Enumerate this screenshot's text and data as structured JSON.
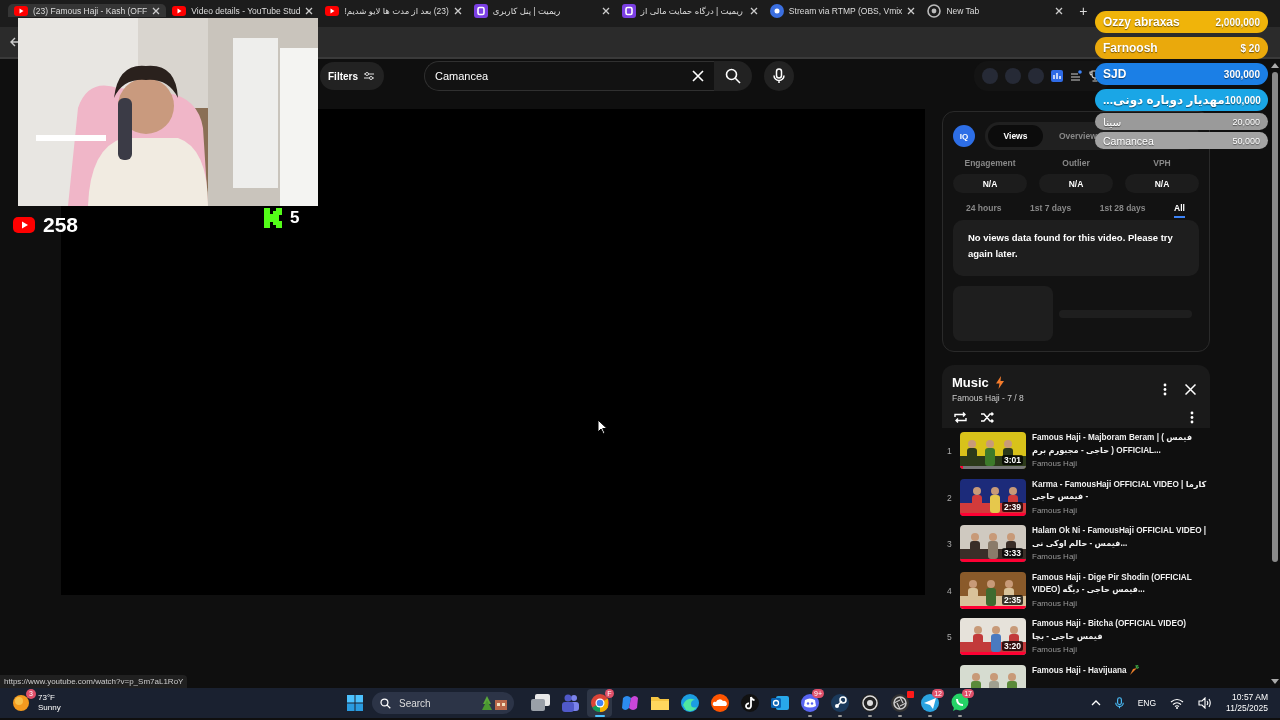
{
  "browser": {
    "tabs": [
      {
        "title": "(23) Famous Haji - Kash (OFF",
        "kind": "youtube",
        "selected": true
      },
      {
        "title": "Video details - YouTube Stud",
        "kind": "youtube",
        "selected": false
      },
      {
        "title": "(23) بعد از مدت ها لایو شدیم!",
        "kind": "youtube",
        "selected": false
      },
      {
        "title": "ریمیت | پنل کاربری",
        "kind": "square",
        "selected": false
      },
      {
        "title": "ریمیت | درگاه حمایت مالی از",
        "kind": "square",
        "selected": false
      },
      {
        "title": "Stream via RTMP (OBS, Vmix",
        "kind": "round",
        "selected": false
      },
      {
        "title": "New Tab",
        "kind": "chrome",
        "selected": false
      }
    ],
    "new_tab": "+"
  },
  "header": {
    "filters": "Filters",
    "search": {
      "value": "Camancea"
    }
  },
  "insights": {
    "badge": "IQ",
    "tabs": [
      {
        "label": "Views",
        "selected": true
      },
      {
        "label": "Overview",
        "selected": false
      }
    ],
    "metrics": [
      {
        "label": "Engagement",
        "value": "N/A"
      },
      {
        "label": "Outlier",
        "value": "N/A"
      },
      {
        "label": "VPH",
        "value": "N/A"
      }
    ],
    "ranges": [
      {
        "label": "24 hours",
        "selected": false
      },
      {
        "label": "1st 7 days",
        "selected": false
      },
      {
        "label": "1st 28 days",
        "selected": false
      },
      {
        "label": "All",
        "selected": true
      }
    ],
    "message": "No views data found for this video. Please try again later."
  },
  "playlist": {
    "title": "Music",
    "subtitle": "Famous Haji - 7 / 8",
    "items": [
      {
        "index": "1",
        "title": "Famous Haji - Majboram Beram | ( فیمس حاجی - مجبورم برم ) OFFICIAL...",
        "channel": "Famous Haji",
        "duration": "3:01",
        "level": 0.05
      },
      {
        "index": "2",
        "title": "Karma - FamousHaji OFFICIAL VIDEO | کارما - فیمس حاجی",
        "channel": "Famous Haji",
        "duration": "2:39",
        "level": 1
      },
      {
        "index": "3",
        "title": "Halam Ok Ni - FamousHaji OFFICIAL VIDEO | فیمس - حالم اوکی نی...",
        "channel": "Famous Haji",
        "duration": "3:33",
        "level": 1
      },
      {
        "index": "4",
        "title": "Famous Haji - Dige Pir Shodin (OFFICIAL VIDEO) فیمس حاجی - دیگه...",
        "channel": "Famous Haji",
        "duration": "2:35",
        "level": 1
      },
      {
        "index": "5",
        "title": "Famous Haji - Bitcha (OFFICIAL VIDEO) فیمس حاجی - بچا",
        "channel": "Famous Haji",
        "duration": "3:20",
        "level": 1
      },
      {
        "title": "Famous Haji - Havijuana"
      }
    ]
  },
  "status_url": "https://www.youtube.com/watch?v=p_Sm7aL1RoY",
  "stream_overlay": {
    "viewers": [
      {
        "kind": "youtube",
        "count": "258"
      },
      {
        "kind": "kick",
        "count": "5"
      }
    ],
    "donations": [
      {
        "name": "Ozzy abraxas",
        "amount": "2,000,000",
        "color": "#f0b40a",
        "kind": "large"
      },
      {
        "name": "Farnoosh",
        "amount": "$ 20",
        "color": "#eaa90c",
        "kind": "large"
      },
      {
        "name": "SJD",
        "amount": "300,000",
        "color": "#1b7fe6",
        "kind": "large"
      },
      {
        "name": "مهدیار دوباره دونی...",
        "amount": "100,000",
        "color": "#1aa6e6",
        "kind": "large"
      },
      {
        "name": "سینا",
        "amount": "20,000",
        "color": "#9a9a9a",
        "kind": "small"
      },
      {
        "name": "Camancea",
        "amount": "50,000",
        "color": "#a3a3a3",
        "kind": "small"
      }
    ]
  },
  "taskbar": {
    "weather": {
      "badge": "3",
      "temp": "73°F",
      "condition": "Sunny"
    },
    "search": {
      "placeholder": "Search"
    },
    "apps": [
      {
        "kind": "taskview",
        "running": false,
        "selected": false,
        "alert": false
      },
      {
        "kind": "teams",
        "running": false,
        "selected": false,
        "alert": false
      },
      {
        "kind": "chrome",
        "running": true,
        "selected": true,
        "badge": "F",
        "alert": false
      },
      {
        "kind": "copilot",
        "running": false,
        "selected": false,
        "alert": false
      },
      {
        "kind": "files",
        "running": false,
        "selected": false,
        "alert": false
      },
      {
        "kind": "edge",
        "running": false,
        "selected": false,
        "alert": false
      },
      {
        "kind": "soundcloud",
        "running": false,
        "selected": false,
        "alert": false
      },
      {
        "kind": "tiktok",
        "running": false,
        "selected": false,
        "alert": false
      },
      {
        "kind": "outlook",
        "running": false,
        "selected": false,
        "alert": false
      },
      {
        "kind": "discord",
        "running": true,
        "selected": false,
        "badge": "9+",
        "alert": false
      },
      {
        "kind": "steam",
        "running": true,
        "selected": false,
        "alert": false
      },
      {
        "kind": "obs",
        "running": true,
        "selected": false,
        "alert": false
      },
      {
        "kind": "camera",
        "running": true,
        "selected": false,
        "alert": true
      },
      {
        "kind": "telegram",
        "running": true,
        "selected": false,
        "badge": "12",
        "alert": false
      },
      {
        "kind": "whatsapp",
        "running": true,
        "selected": false,
        "badge": "17",
        "alert": false
      }
    ],
    "tray": {
      "language": "ENG",
      "time": "10:57 AM",
      "date": "11/25/2025"
    }
  }
}
